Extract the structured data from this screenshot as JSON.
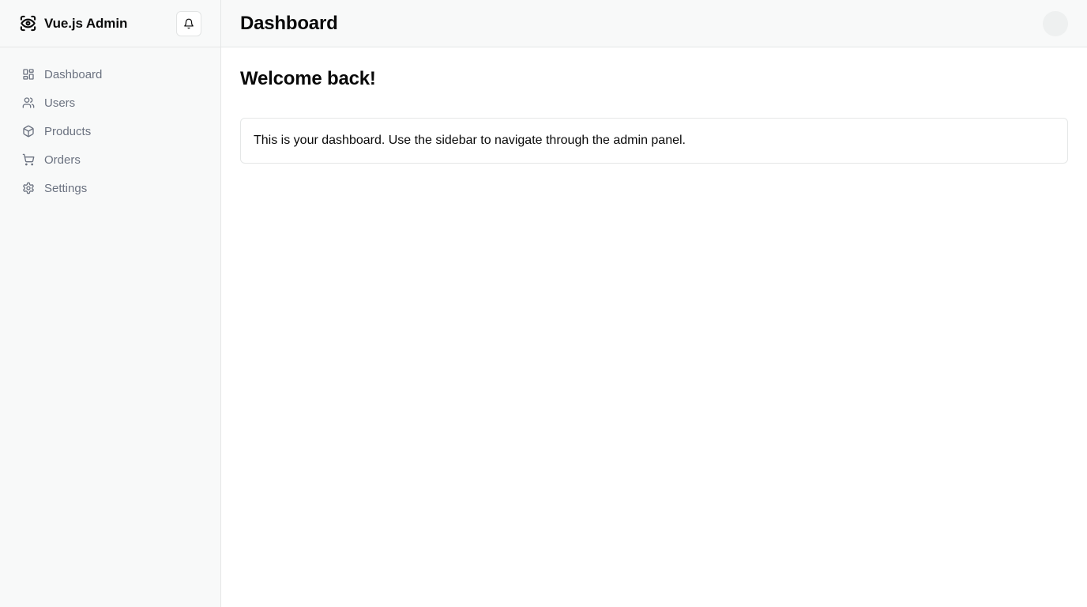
{
  "app": {
    "title": "Vue.js Admin"
  },
  "sidebar": {
    "items": [
      {
        "label": "Dashboard",
        "icon": "dashboard-grid-icon"
      },
      {
        "label": "Users",
        "icon": "users-icon"
      },
      {
        "label": "Products",
        "icon": "box-icon"
      },
      {
        "label": "Orders",
        "icon": "cart-icon"
      },
      {
        "label": "Settings",
        "icon": "gear-icon"
      }
    ]
  },
  "header": {
    "title": "Dashboard"
  },
  "main": {
    "heading": "Welcome back!",
    "card_text": "This is your dashboard. Use the sidebar to navigate through the admin panel."
  },
  "colors": {
    "sidebar_bg": "#f8f9f9",
    "border": "#e5e7e7",
    "nav_text": "#6b7280",
    "text": "#0a0a0a"
  }
}
